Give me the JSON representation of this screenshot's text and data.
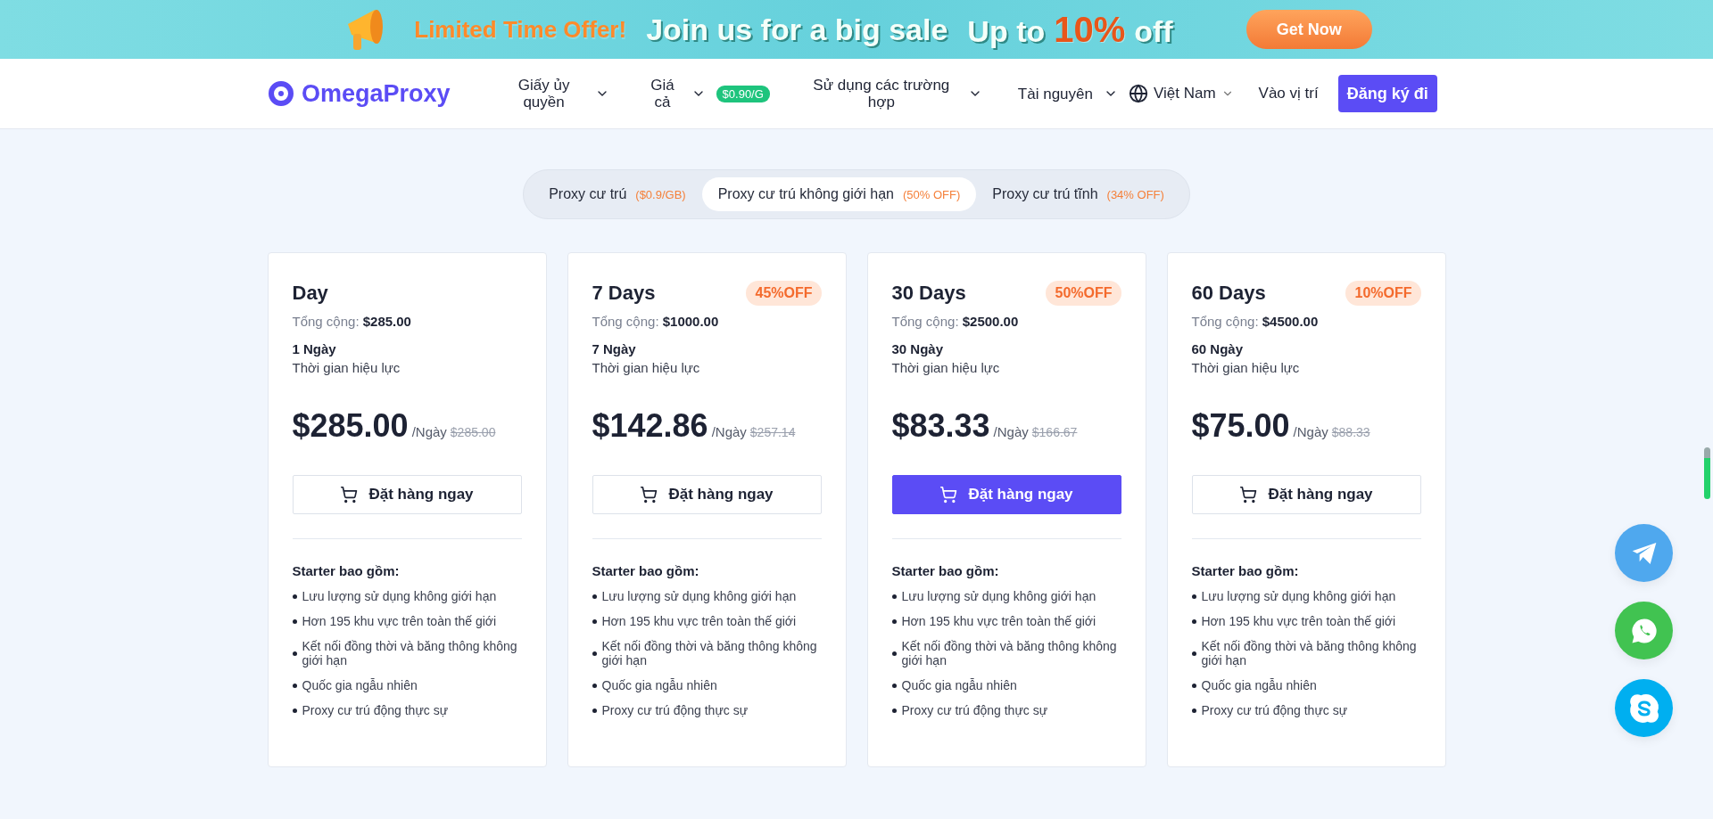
{
  "banner": {
    "offer": "Limited Time Offer!",
    "headline": "Join us for a big sale",
    "promo_prefix": "Up to",
    "promo_highlight": "10%",
    "promo_suffix": "off",
    "button": "Get Now"
  },
  "nav": {
    "logo": "OmegaProxy",
    "items": [
      {
        "label": "Giấy ủy quyền",
        "dropdown": true
      },
      {
        "label": "Giá cả",
        "dropdown": true,
        "badge": "$0.90/G"
      },
      {
        "label": "Sử dụng các trường hợp",
        "dropdown": true
      },
      {
        "label": "Tài nguyên",
        "dropdown": true
      }
    ],
    "language": "Việt Nam",
    "login": "Vào vị trí",
    "signup": "Đăng ký đi"
  },
  "tabs": [
    {
      "label": "Proxy cư trú",
      "note": "($0.9/GB)",
      "selected": false
    },
    {
      "label": "Proxy cư trú không giới hạn",
      "note": "(50% OFF)",
      "selected": true
    },
    {
      "label": "Proxy cư trú tĩnh",
      "note": "(34% OFF)",
      "selected": false
    }
  ],
  "plans": [
    {
      "name": "Day",
      "total_label": "Tổng cộng:",
      "total": "$285.00",
      "duration": "1 Ngày",
      "duration_label": "Thời gian hiệu lực",
      "price": "$285.00",
      "unit": "/Ngày",
      "old_price": "$285.00",
      "button": "Đặt hàng ngay",
      "featured": false,
      "includes_title": "Starter bao gồm:",
      "features": [
        "Lưu lượng sử dụng không giới hạn",
        "Hơn 195 khu vực trên toàn thế giới",
        "Kết nối đồng thời và băng thông không giới hạn",
        "Quốc gia ngẫu nhiên",
        "Proxy cư trú động thực sự"
      ]
    },
    {
      "name": "7 Days",
      "badge": "45%OFF",
      "total_label": "Tổng cộng:",
      "total": "$1000.00",
      "duration": "7 Ngày",
      "duration_label": "Thời gian hiệu lực",
      "price": "$142.86",
      "unit": "/Ngày",
      "old_price": "$257.14",
      "button": "Đặt hàng ngay",
      "featured": false,
      "includes_title": "Starter bao gồm:",
      "features": [
        "Lưu lượng sử dụng không giới hạn",
        "Hơn 195 khu vực trên toàn thế giới",
        "Kết nối đồng thời và băng thông không giới hạn",
        "Quốc gia ngẫu nhiên",
        "Proxy cư trú động thực sự"
      ]
    },
    {
      "name": "30 Days",
      "badge": "50%OFF",
      "total_label": "Tổng cộng:",
      "total": "$2500.00",
      "duration": "30 Ngày",
      "duration_label": "Thời gian hiệu lực",
      "price": "$83.33",
      "unit": "/Ngày",
      "old_price": "$166.67",
      "button": "Đặt hàng ngay",
      "featured": true,
      "includes_title": "Starter bao gồm:",
      "features": [
        "Lưu lượng sử dụng không giới hạn",
        "Hơn 195 khu vực trên toàn thế giới",
        "Kết nối đồng thời và băng thông không giới hạn",
        "Quốc gia ngẫu nhiên",
        "Proxy cư trú động thực sự"
      ]
    },
    {
      "name": "60 Days",
      "badge": "10%OFF",
      "total_label": "Tổng cộng:",
      "total": "$4500.00",
      "duration": "60 Ngày",
      "duration_label": "Thời gian hiệu lực",
      "price": "$75.00",
      "unit": "/Ngày",
      "old_price": "$88.33",
      "button": "Đặt hàng ngay",
      "featured": false,
      "includes_title": "Starter bao gồm:",
      "features": [
        "Lưu lượng sử dụng không giới hạn",
        "Hơn 195 khu vực trên toàn thế giới",
        "Kết nối đồng thời và băng thông không giới hạn",
        "Quốc gia ngẫu nhiên",
        "Proxy cư trú động thực sự"
      ]
    }
  ],
  "contacts": [
    {
      "kind": "telegram",
      "color": "#4fa8ee"
    },
    {
      "kind": "whatsapp",
      "color": "#41c351"
    },
    {
      "kind": "skype",
      "color": "#00aff0"
    }
  ]
}
